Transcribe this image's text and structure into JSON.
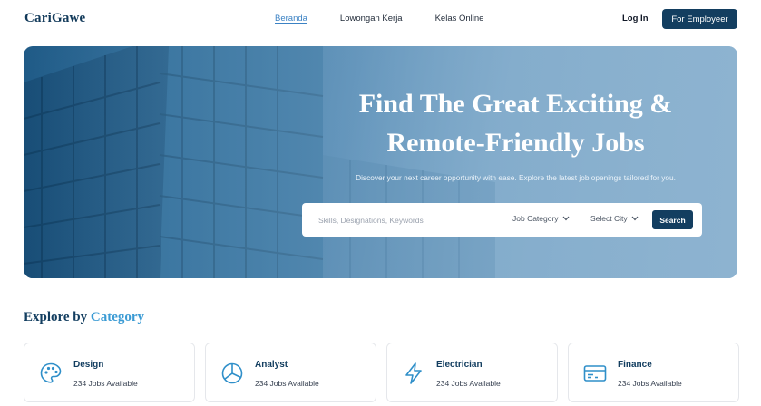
{
  "header": {
    "logo": "CariGawe",
    "nav": [
      "Beranda",
      "Lowongan Kerja",
      "Kelas Online"
    ],
    "login": "Log In",
    "employer": "For Employeer"
  },
  "hero": {
    "title_line1": "Find The Great Exciting &",
    "title_line2": "Remote-Friendly Jobs",
    "subtitle": "Discover your next career opportunity with ease. Explore the latest job openings tailored for you."
  },
  "search": {
    "placeholder": "Skills, Designations, Keywords",
    "category": "Job Category",
    "city": "Select City",
    "button": "Search"
  },
  "explore": {
    "title_plain": "Explore by",
    "title_accent": "Category"
  },
  "categories": [
    {
      "name": "Design",
      "count": "234 Jobs Available",
      "icon": "palette-icon"
    },
    {
      "name": "Analyst",
      "count": "234 Jobs Available",
      "icon": "pie-chart-icon"
    },
    {
      "name": "Electrician",
      "count": "234 Jobs Available",
      "icon": "lightning-icon"
    },
    {
      "name": "Finance",
      "count": "234 Jobs Available",
      "icon": "credit-card-icon"
    }
  ],
  "colors": {
    "primary": "#133e60",
    "accent": "#3b9bd4",
    "link_active": "#3b82c4"
  }
}
